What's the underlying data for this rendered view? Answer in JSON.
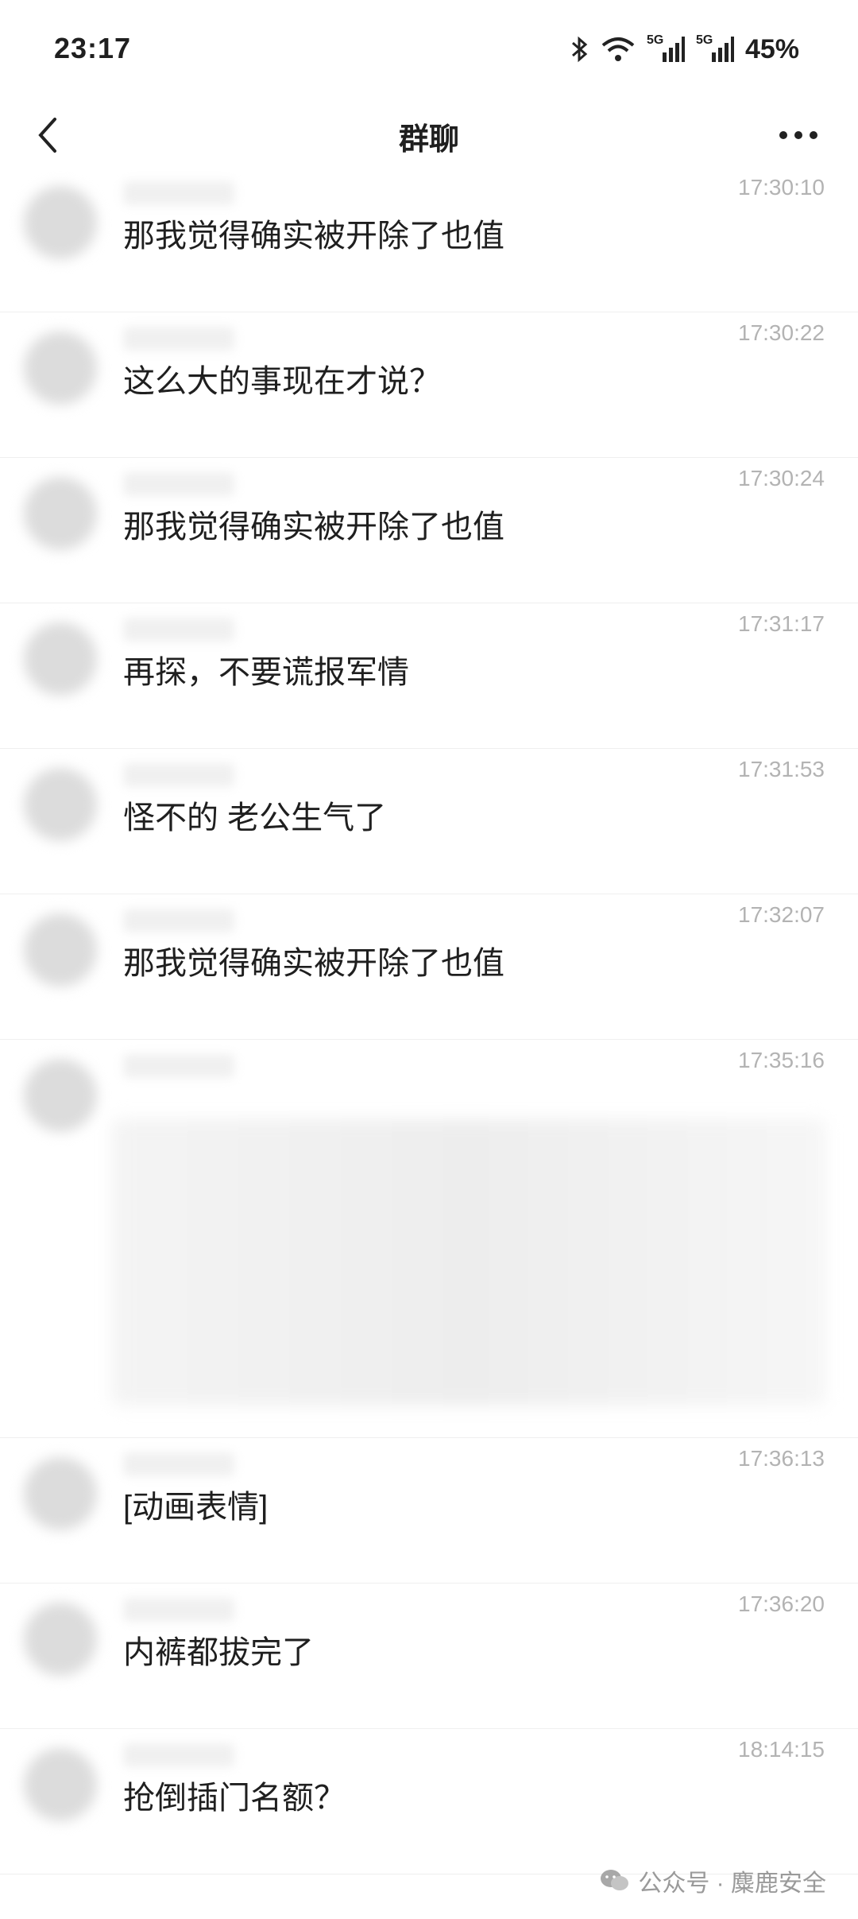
{
  "status_bar": {
    "time": "23:17",
    "signal_labels": [
      "5G",
      "5G"
    ],
    "battery": "45%",
    "icons": [
      "bluetooth-icon",
      "wifi-icon",
      "signal-icon",
      "signal-icon"
    ]
  },
  "nav": {
    "title": "群聊",
    "back_icon": "chevron-left-icon",
    "more_icon": "more-icon"
  },
  "messages": [
    {
      "time": "17:30:10",
      "text": "那我觉得确实被开除了也值"
    },
    {
      "time": "17:30:22",
      "text": "这么大的事现在才说？"
    },
    {
      "time": "17:30:24",
      "text": "那我觉得确实被开除了也值"
    },
    {
      "time": "17:31:17",
      "text": "再探，不要谎报军情"
    },
    {
      "time": "17:31:53",
      "text": "怪不的 老公生气了"
    },
    {
      "time": "17:32:07",
      "text": "那我觉得确实被开除了也值"
    },
    {
      "time": "17:35:16",
      "text": ""
    },
    {
      "time": "17:36:13",
      "text": "[动画表情]"
    },
    {
      "time": "17:36:20",
      "text": "内裤都拔完了"
    },
    {
      "time": "18:14:15",
      "text": "抢倒插门名额？"
    }
  ],
  "watermark": "公众号 · 麋鹿安全"
}
